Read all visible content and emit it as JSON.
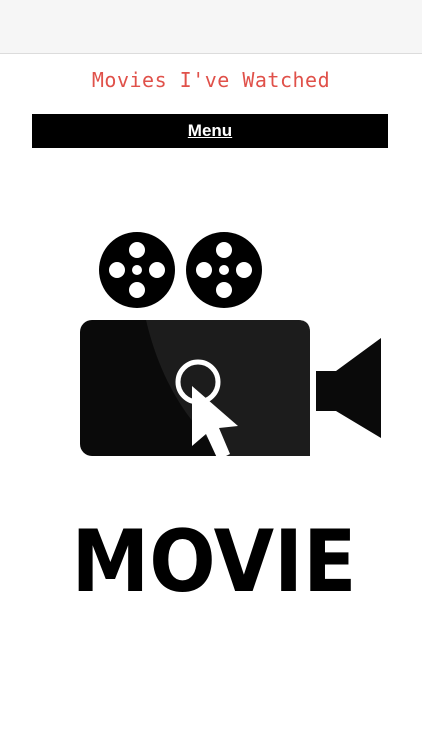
{
  "page": {
    "title": "Movies I've Watched"
  },
  "nav": {
    "menu_label": "Menu"
  },
  "hero_image": {
    "icon": "movie-camera-icon",
    "caption": "MOVIE"
  },
  "colors": {
    "title": "#e0514a",
    "menu_bg": "#000000",
    "menu_text": "#ffffff"
  }
}
